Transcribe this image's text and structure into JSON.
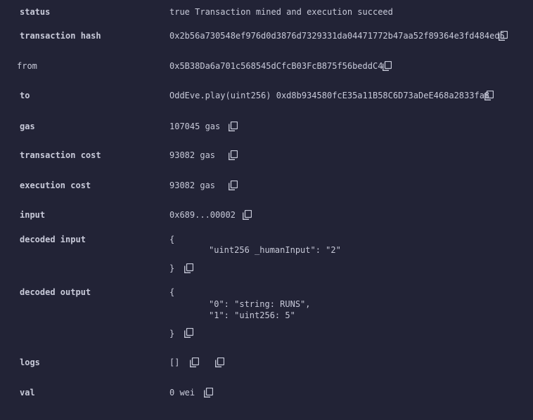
{
  "rows": {
    "status": {
      "label": "status",
      "value": "true Transaction mined and execution succeed"
    },
    "hash": {
      "label": "transaction hash",
      "value": "0x2b56a730548ef976d0d3876d7329331da04471772b47aa52f89364e3fd484ed5"
    },
    "from": {
      "label": "from",
      "value": "0x5B38Da6a701c568545dCfcB03FcB875f56beddC4"
    },
    "to": {
      "label": "to",
      "value": "OddEve.play(uint256) 0xd8b934580fcE35a11B58C6D73aDeE468a2833fa8"
    },
    "gas": {
      "label": "gas",
      "value": "107045 gas"
    },
    "tx_cost": {
      "label": "transaction cost",
      "value": "93082 gas"
    },
    "exec_cost": {
      "label": "execution cost",
      "value": "93082 gas"
    },
    "input": {
      "label": "input",
      "value": "0x689...00002"
    },
    "decoded_input": {
      "label": "decoded input",
      "open": "{",
      "line1": "\"uint256 _humanInput\": \"2\"",
      "close": "}"
    },
    "decoded_output": {
      "label": "decoded output",
      "open": "{",
      "line1": "\"0\": \"string: RUNS\",",
      "line2": "\"1\": \"uint256: 5\"",
      "close": "}"
    },
    "logs": {
      "label": "logs",
      "value": "[]"
    },
    "val": {
      "label": "val",
      "value": "0 wei"
    }
  },
  "icons": {
    "copy": "copy-icon"
  },
  "colors": {
    "background": "#222336",
    "text": "#c8cad9"
  }
}
